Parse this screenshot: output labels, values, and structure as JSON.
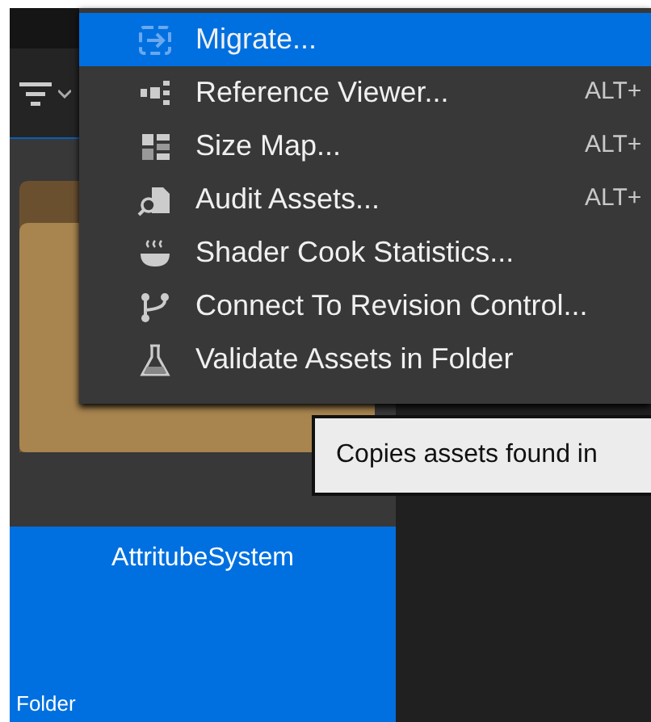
{
  "asset_tile": {
    "name": "AttritubeSystem",
    "type_label": "Folder",
    "selected": true
  },
  "context_menu": {
    "items": [
      {
        "label": "Migrate...",
        "selected": true
      },
      {
        "label": "Reference Viewer...",
        "shortcut": "ALT+",
        "selected": false
      },
      {
        "label": "Size Map...",
        "shortcut": "ALT+",
        "selected": false
      },
      {
        "label": "Audit Assets...",
        "shortcut": "ALT+",
        "selected": false
      },
      {
        "label": "Shader Cook Statistics...",
        "selected": false
      },
      {
        "label": "Connect To Revision Control...",
        "selected": false
      },
      {
        "label": "Validate Assets in Folder",
        "selected": false
      }
    ]
  },
  "tooltip": {
    "text": "Copies assets found in"
  }
}
